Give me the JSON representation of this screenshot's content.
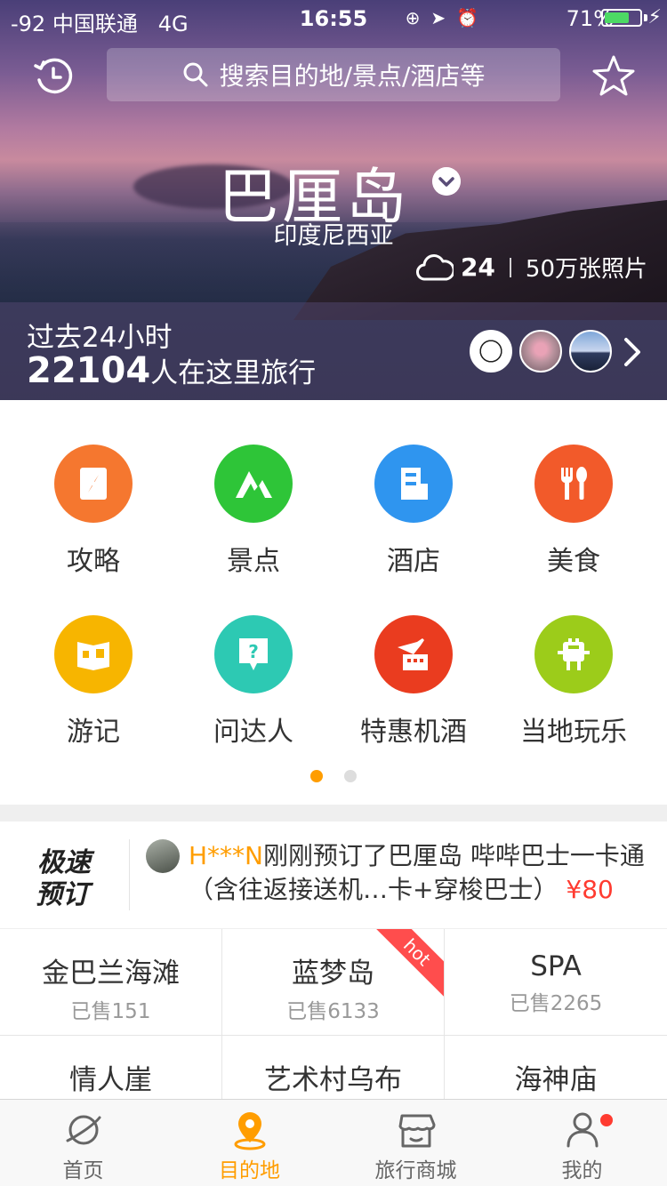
{
  "status_bar": {
    "signal": "-92",
    "carrier": "中国联通",
    "network": "4G",
    "time": "16:55",
    "battery": "71%",
    "battery_level": 0.71
  },
  "header": {
    "search_placeholder": "搜索目的地/景点/酒店等",
    "icons": {
      "history": "history-clock-icon",
      "favorite": "star-icon"
    }
  },
  "destination": {
    "city": "巴厘岛",
    "country": "印度尼西亚",
    "temperature": "24",
    "photos": "50万张照片"
  },
  "travel_stats": {
    "period": "过去24小时",
    "count": "22104",
    "suffix": "人在这里旅行"
  },
  "categories": [
    {
      "label": "攻略",
      "color": "#f5772f",
      "icon": "guide-book-icon"
    },
    {
      "label": "景点",
      "color": "#2ec538",
      "icon": "mountain-icon"
    },
    {
      "label": "酒店",
      "color": "#2f95ef",
      "icon": "hotel-building-icon"
    },
    {
      "label": "美食",
      "color": "#f25a2a",
      "icon": "fork-spoon-icon"
    },
    {
      "label": "游记",
      "color": "#f7b500",
      "icon": "travel-notes-icon"
    },
    {
      "label": "问达人",
      "color": "#2dc9b3",
      "icon": "question-bubble-icon"
    },
    {
      "label": "特惠机酒",
      "color": "#ea3c1f",
      "icon": "flight-hotel-icon"
    },
    {
      "label": "当地玩乐",
      "color": "#9ccc1a",
      "icon": "local-fun-icon"
    }
  ],
  "booking": {
    "logo_lines": [
      "极速",
      "预订"
    ],
    "user": "H***N",
    "message": "刚刚预订了巴厘岛 哔哔巴士一卡通（含往返接送机…卡+穿梭巴士）",
    "price": "¥80"
  },
  "hot_items": [
    {
      "name": "金巴兰海滩",
      "sold": "已售151"
    },
    {
      "name": "蓝梦岛",
      "sold": "已售6133",
      "badge": "hot"
    },
    {
      "name": "SPA",
      "sold": "已售2265"
    },
    {
      "name": "情人崖",
      "sold": ""
    },
    {
      "name": "艺术村乌布",
      "sold": ""
    },
    {
      "name": "海神庙",
      "sold": ""
    }
  ],
  "tabbar": [
    {
      "label": "首页",
      "icon": "planet-icon"
    },
    {
      "label": "目的地",
      "icon": "location-pin-icon",
      "active": true
    },
    {
      "label": "旅行商城",
      "icon": "shop-icon"
    },
    {
      "label": "我的",
      "icon": "person-icon"
    }
  ],
  "colors": {
    "accent": "#ff9d00",
    "price": "#ff3b30"
  }
}
